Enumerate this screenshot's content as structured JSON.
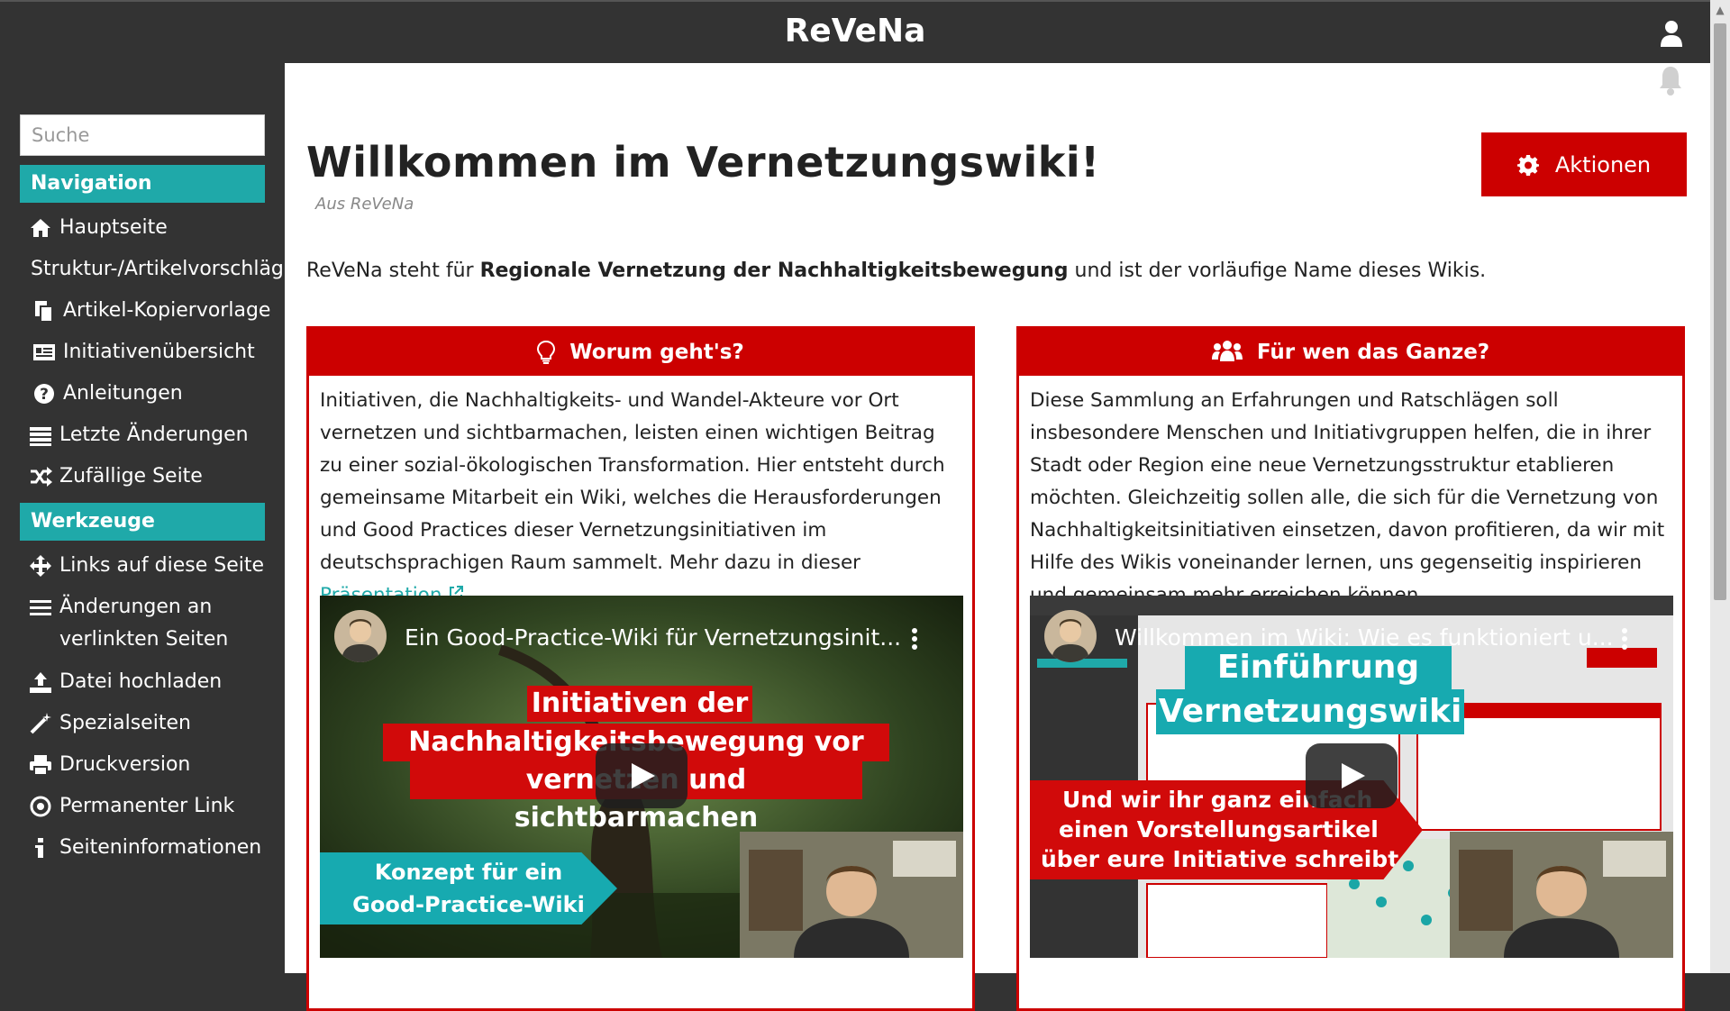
{
  "app": {
    "brand": "ReVeNa"
  },
  "sidebar": {
    "search_placeholder": "Suche",
    "sections": [
      {
        "title": "Navigation"
      },
      {
        "title": "Werkzeuge"
      }
    ],
    "navigation": [
      {
        "label": "Hauptseite",
        "icon": "home-icon"
      },
      {
        "label": "Struktur-/Artikelvorschläge",
        "icon": ""
      },
      {
        "label": "Artikel-Kopiervorlage",
        "icon": "copy-icon"
      },
      {
        "label": "Initiativenübersicht",
        "icon": "list-card-icon"
      },
      {
        "label": "Anleitungen",
        "icon": "question-icon"
      },
      {
        "label": "Letzte Änderungen",
        "icon": "changes-icon"
      },
      {
        "label": "Zufällige Seite",
        "icon": "shuffle-icon"
      }
    ],
    "tools": [
      {
        "label": "Links auf diese Seite",
        "icon": "move-arrows-icon"
      },
      {
        "label": "Änderungen an verlinkten Seiten",
        "icon": "bars-icon"
      },
      {
        "label": "Datei hochladen",
        "icon": "upload-icon"
      },
      {
        "label": "Spezialseiten",
        "icon": "wand-icon"
      },
      {
        "label": "Druckversion",
        "icon": "print-icon"
      },
      {
        "label": "Permanenter Link",
        "icon": "target-icon"
      },
      {
        "label": "Seiteninformationen",
        "icon": "info-icon"
      }
    ]
  },
  "page": {
    "title": "Willkommen im Vernetzungswiki!",
    "subtitle": "Aus ReVeNa",
    "actions_label": "Aktionen",
    "intro_pre": "ReVeNa steht für ",
    "intro_bold": "Regionale Vernetzung der Nachhaltigkeitsbewegung",
    "intro_post": " und ist der vorläufige Name dieses Wikis."
  },
  "boxes": [
    {
      "heading": "Worum geht's?",
      "text": "Initiativen, die Nachhaltigkeits- und Wandel-Akteure vor Ort vernetzen und sichtbarmachen, leisten einen wichtigen Beitrag zu einer sozial-ökologischen Transformation. Hier entsteht durch gemeinsame Mitarbeit ein Wiki, welches die Herausforderungen und Good Practices dieser Vernetzungsinitiativen im deutschsprachigen Raum sammelt. Mehr dazu in dieser ",
      "link": "Präsentation",
      "after_link": ".",
      "video": {
        "title": "Ein Good-Practice-Wiki für Vernetzungsinit...",
        "red_banner_lines": [
          "Initiativen der",
          "Nachhaltigkeitsbewegung vor Ort",
          "vernetzen und sichtbarmachen"
        ],
        "teal_banner_lines": [
          "Konzept für ein",
          "Good-Practice-Wiki"
        ]
      }
    },
    {
      "heading": "Für wen das Ganze?",
      "text": "Diese Sammlung an Erfahrungen und Ratschlägen soll insbesondere Menschen und Initiativgruppen helfen, die in ihrer Stadt oder Region eine neue Vernetzungsstruktur etablieren möchten. Gleichzeitig sollen alle, die sich für die Vernetzung von Nachhaltigkeitsinitiativen einsetzen, davon profitieren, da wir mit Hilfe des Wikis voneinander lernen, uns gegenseitig inspirieren und gemeinsam mehr erreichen können.",
      "video": {
        "title": "Willkommen im Wiki: Wie es funktioniert u...",
        "teal_banner_lines": [
          "Einführung ins",
          "Vernetzungswiki"
        ],
        "red_banner_lines": [
          "Und wir ihr ganz einfach",
          "einen Vorstellungsartikel",
          "über eure Initiative schreibt"
        ]
      }
    }
  ],
  "colors": {
    "accent_red": "#cc0000",
    "accent_teal": "#1fa9a9",
    "dark": "#333333"
  }
}
